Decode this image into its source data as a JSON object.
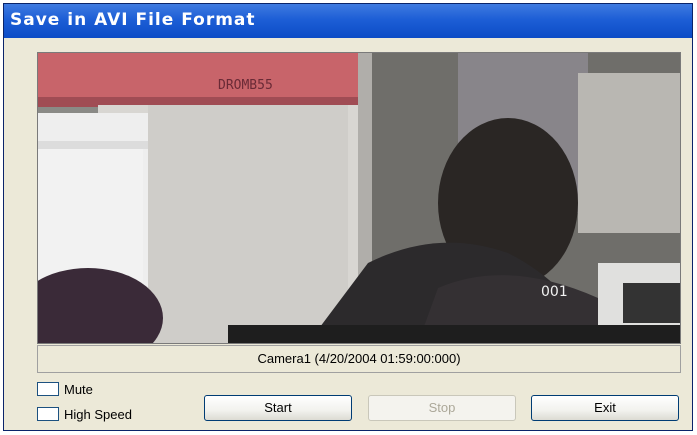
{
  "window": {
    "title": "Save in AVI File Format"
  },
  "video": {
    "overlay_text": "001",
    "sign_text": "DROMB55",
    "caption": "Camera1 (4/20/2004  01:59:00:000)"
  },
  "options": {
    "mute_label": "Mute",
    "mute_checked": false,
    "high_speed_label": "High Speed",
    "high_speed_checked": false
  },
  "buttons": {
    "start_label": "Start",
    "stop_label": "Stop",
    "stop_enabled": false,
    "exit_label": "Exit"
  },
  "colors": {
    "title_bar": "#1d5ed6",
    "window_bg": "#ece9d8",
    "button_border": "#003c74",
    "disabled_text": "#aca899"
  }
}
